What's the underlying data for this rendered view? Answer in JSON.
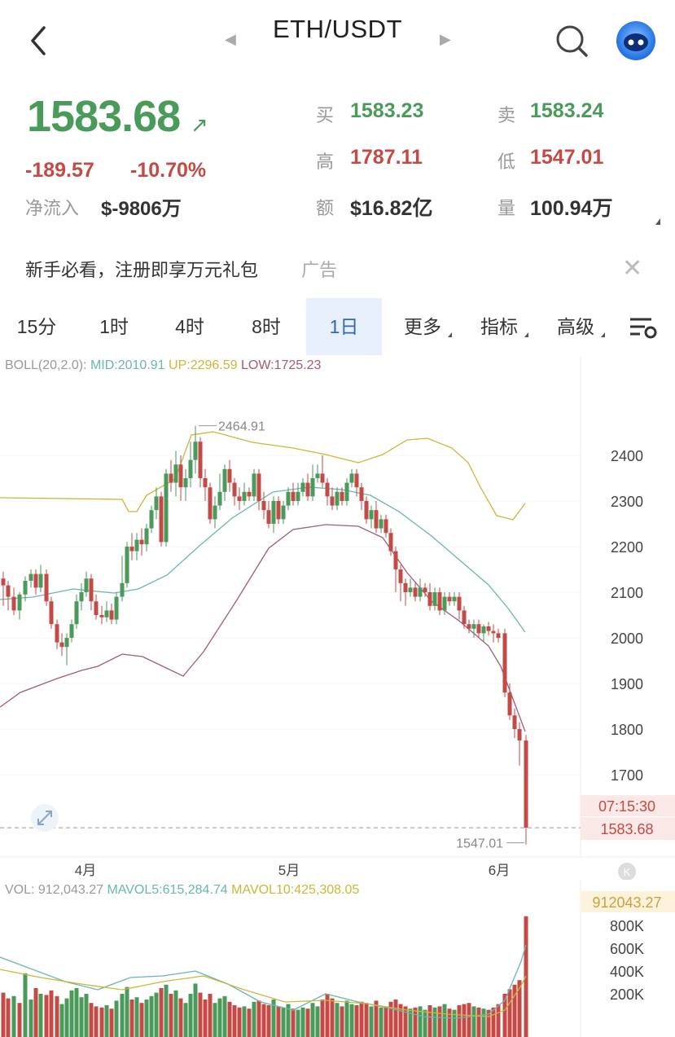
{
  "header": {
    "title": "ETH/USDT",
    "prev_icon": "caret-left-icon",
    "next_icon": "caret-right-icon"
  },
  "price": {
    "last": "1583.68",
    "change": "-189.57",
    "change_pct": "-10.70%",
    "netflow_label": "净流入",
    "netflow_value": "$-9806万"
  },
  "stats": {
    "buy_label": "买",
    "buy": "1583.23",
    "sell_label": "卖",
    "sell": "1583.24",
    "high_label": "高",
    "high": "1787.11",
    "low_label": "低",
    "low": "1547.01",
    "amount_label": "额",
    "amount": "$16.82亿",
    "volume_label": "量",
    "volume": "100.94万"
  },
  "ad": {
    "text": "新手必看，注册即享万元礼包",
    "tag": "广告",
    "close": "✕"
  },
  "timeframes": [
    {
      "label": "15分",
      "active": false
    },
    {
      "label": "1时",
      "active": false
    },
    {
      "label": "4时",
      "active": false
    },
    {
      "label": "8时",
      "active": false
    },
    {
      "label": "1日",
      "active": true
    },
    {
      "label": "更多",
      "active": false
    },
    {
      "label": "指标",
      "active": false
    },
    {
      "label": "高级",
      "active": false
    }
  ],
  "boll": {
    "name": "BOLL(20,2.0):",
    "mid": "MID:2010.91",
    "up": "UP:2296.59",
    "low": "LOW:1725.23"
  },
  "vol_legend": {
    "vol": "VOL: 912,043.27",
    "ma5": "MAVOL5:615,284.74",
    "ma10": "MAVOL10:425,308.05"
  },
  "chart_data": {
    "type": "candlestick",
    "y_ticks": [
      "2400",
      "2300",
      "2200",
      "2100",
      "2000",
      "1900",
      "1800",
      "1700"
    ],
    "y_range": [
      1530,
      2560
    ],
    "x_months": [
      "4月",
      "5月",
      "6月"
    ],
    "max_marker": "2464.91",
    "min_marker": "1547.01",
    "countdown": "07:15:30",
    "current_price": "1583.68",
    "colors": {
      "up": "#4a9a5a",
      "down": "#c44a45",
      "mid": "#6ab7b0",
      "upper": "#c9b83a",
      "lower": "#a35a7a"
    },
    "vol_ticks": [
      "800K",
      "600K",
      "400K",
      "200K"
    ],
    "vol_current": "912043.27",
    "vol_range": [
      0,
      880000
    ]
  }
}
